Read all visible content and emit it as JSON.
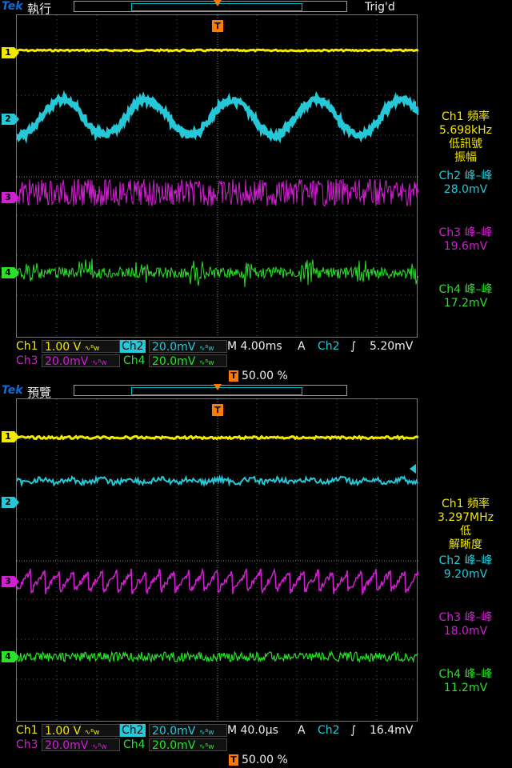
{
  "screens": [
    {
      "brand": "Tek",
      "mode": "執行",
      "trig_status": "Trig'd",
      "trigger_marker": "T",
      "channel_markers": [
        "1",
        "2",
        "3",
        "4"
      ],
      "measurements": {
        "ch1_label": "Ch1 頻率",
        "ch1_value": "5.698kHz",
        "ch1_note1": "低訊號",
        "ch1_note2": "振幅",
        "ch2_label": "Ch2 峰–峰",
        "ch2_value": "28.0mV",
        "ch3_label": "Ch3 峰–峰",
        "ch3_value": "19.6mV",
        "ch4_label": "Ch4 峰–峰",
        "ch4_value": "17.2mV"
      },
      "status": {
        "ch1": "Ch1",
        "ch1_scale": "1.00 V",
        "ch2": "Ch2",
        "ch2_scale": "20.0mV",
        "ch3": "Ch3",
        "ch3_scale": "20.0mV",
        "ch4": "Ch4",
        "ch4_scale": "20.0mV",
        "timebase": "M 4.00ms",
        "trig_mode": "A",
        "trig_source": "Ch2",
        "trig_slope": "∫",
        "trig_level": "5.20mV",
        "trig_pos": "50.00 %",
        "bw_mark": "∿ᴮw"
      }
    },
    {
      "brand": "Tek",
      "mode": "預覽",
      "trig_status": "",
      "trigger_marker": "T",
      "channel_markers": [
        "1",
        "2",
        "3",
        "4"
      ],
      "measurements": {
        "ch1_label": "Ch1 頻率",
        "ch1_value": "3.297MHz",
        "ch1_note1": "低",
        "ch1_note2": "解晰度",
        "ch2_label": "Ch2 峰–峰",
        "ch2_value": "9.20mV",
        "ch3_label": "Ch3 峰–峰",
        "ch3_value": "18.0mV",
        "ch4_label": "Ch4 峰–峰",
        "ch4_value": "11.2mV"
      },
      "status": {
        "ch1": "Ch1",
        "ch1_scale": "1.00 V",
        "ch2": "Ch2",
        "ch2_scale": "20.0mV",
        "ch3": "Ch3",
        "ch3_scale": "20.0mV",
        "ch4": "Ch4",
        "ch4_scale": "20.0mV",
        "timebase": "M 40.0µs",
        "trig_mode": "A",
        "trig_source": "Ch2",
        "trig_slope": "∫",
        "trig_level": "16.4mV",
        "trig_pos": "50.00 %",
        "bw_mark": "∿ᴮw"
      }
    }
  ],
  "colors": {
    "ch1": "#f2e800",
    "ch2": "#26c8d8",
    "ch3": "#d020d0",
    "ch4": "#2ae02a",
    "trigger": "#ff7a00",
    "brand": "#0a6fd6"
  }
}
